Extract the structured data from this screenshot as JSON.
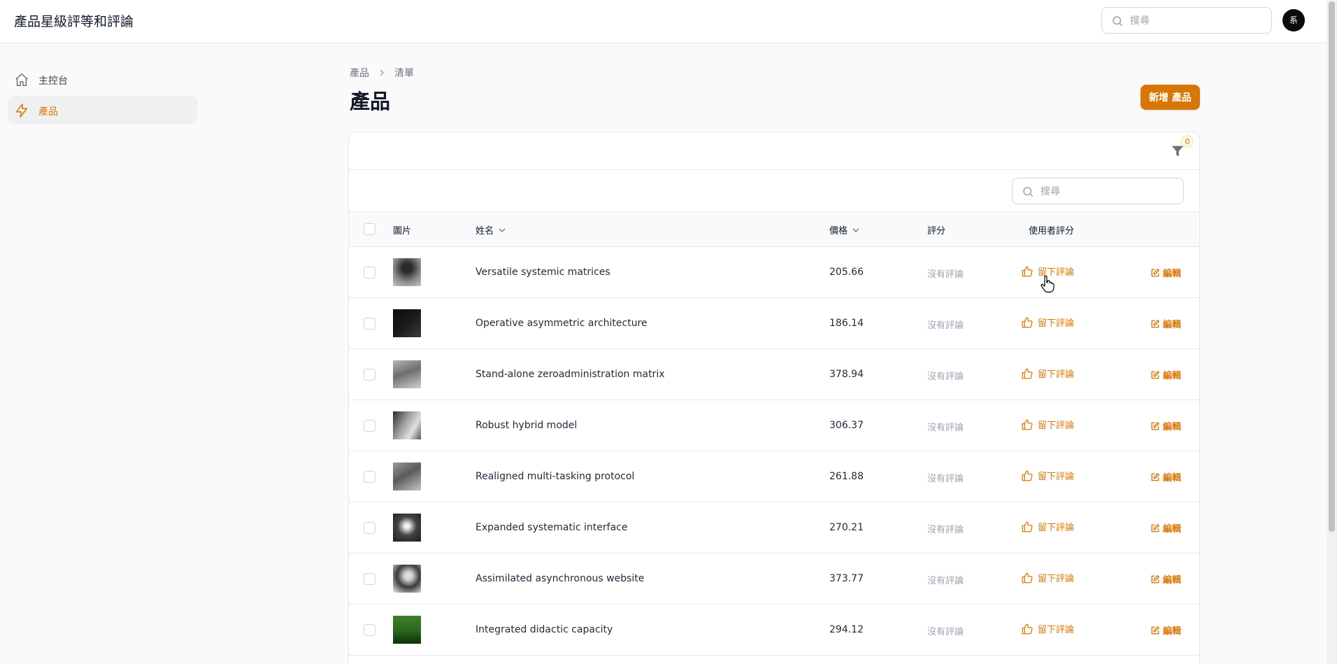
{
  "app": {
    "title": "產品星級評等和評論"
  },
  "header": {
    "search_placeholder": "搜尋",
    "avatar_initial": "系"
  },
  "sidebar": {
    "items": [
      {
        "label": "主控台",
        "icon": "home-icon",
        "active": false
      },
      {
        "label": "產品",
        "icon": "lightning-icon",
        "active": true
      }
    ]
  },
  "page": {
    "breadcrumb": [
      "產品",
      "清單"
    ],
    "title": "產品",
    "new_button": "新增 產品"
  },
  "table": {
    "filter_count": "0",
    "search_placeholder": "搜尋",
    "columns": {
      "image": "圖片",
      "name": "姓名",
      "price": "價格",
      "rating": "評分",
      "user_rating": "使用者評分"
    },
    "rows": [
      {
        "name": "Versatile systemic matrices",
        "price": "205.66",
        "rating": "沒有評論",
        "review": "留下評論",
        "edit": "編輯"
      },
      {
        "name": "Operative asymmetric architecture",
        "price": "186.14",
        "rating": "沒有評論",
        "review": "留下評論",
        "edit": "編輯"
      },
      {
        "name": "Stand-alone zeroadministration matrix",
        "price": "378.94",
        "rating": "沒有評論",
        "review": "留下評論",
        "edit": "編輯"
      },
      {
        "name": "Robust hybrid model",
        "price": "306.37",
        "rating": "沒有評論",
        "review": "留下評論",
        "edit": "編輯"
      },
      {
        "name": "Realigned multi-tasking protocol",
        "price": "261.88",
        "rating": "沒有評論",
        "review": "留下評論",
        "edit": "編輯"
      },
      {
        "name": "Expanded systematic interface",
        "price": "270.21",
        "rating": "沒有評論",
        "review": "留下評論",
        "edit": "編輯"
      },
      {
        "name": "Assimilated asynchronous website",
        "price": "373.77",
        "rating": "沒有評論",
        "review": "留下評論",
        "edit": "編輯"
      },
      {
        "name": "Integrated didactic capacity",
        "price": "294.12",
        "rating": "沒有評論",
        "review": "留下評論",
        "edit": "編輯"
      }
    ]
  },
  "colors": {
    "accent": "#d97706",
    "muted": "#9ca3af"
  }
}
